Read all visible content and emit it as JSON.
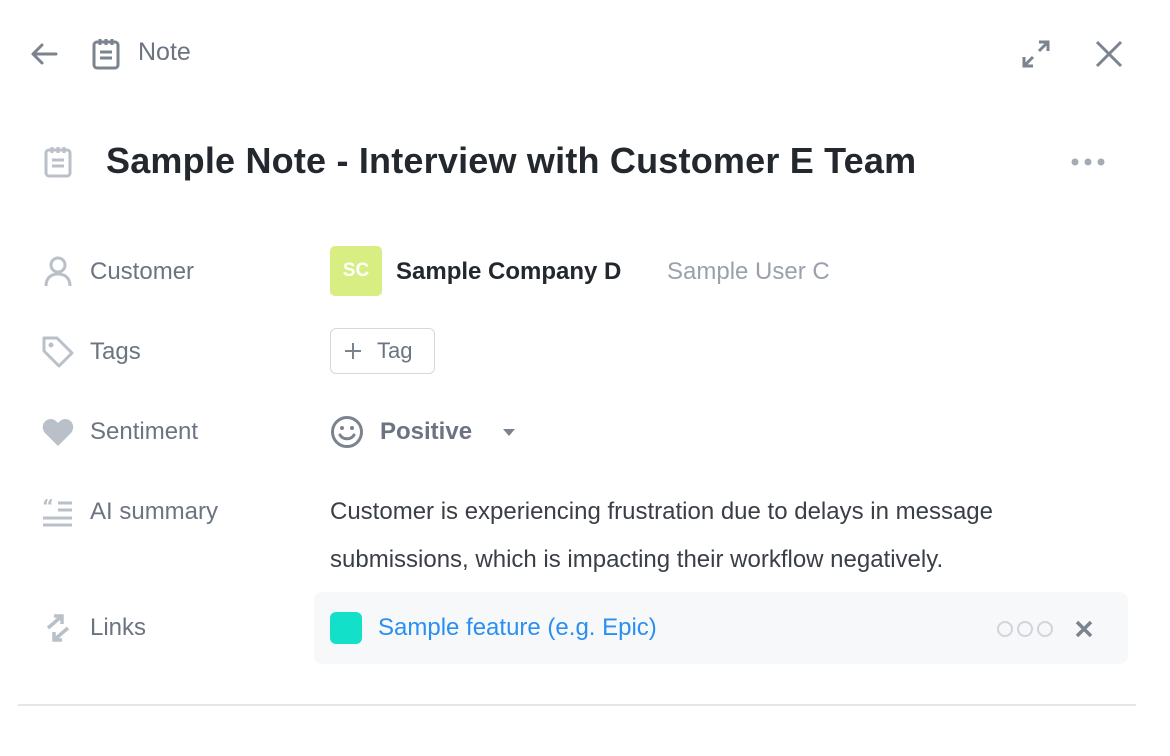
{
  "header": {
    "type_label": "Note"
  },
  "title": "Sample Note - Interview with Customer E Team",
  "fields": {
    "customer": {
      "label": "Customer",
      "avatar_initials": "SC",
      "avatar_color": "#d9ee82",
      "company": "Sample Company D",
      "user": "Sample User C"
    },
    "tags": {
      "label": "Tags",
      "add_label": "Tag"
    },
    "sentiment": {
      "label": "Sentiment",
      "value": "Positive"
    },
    "ai_summary": {
      "label": "AI summary",
      "line1": "Customer is experiencing frustration due to delays in message",
      "line2": "submissions, which is impacting their workflow negatively."
    },
    "links": {
      "label": "Links",
      "item": "Sample feature (e.g. Epic)",
      "item_color": "#13e0c9",
      "link_color": "#2b8ff0"
    }
  }
}
